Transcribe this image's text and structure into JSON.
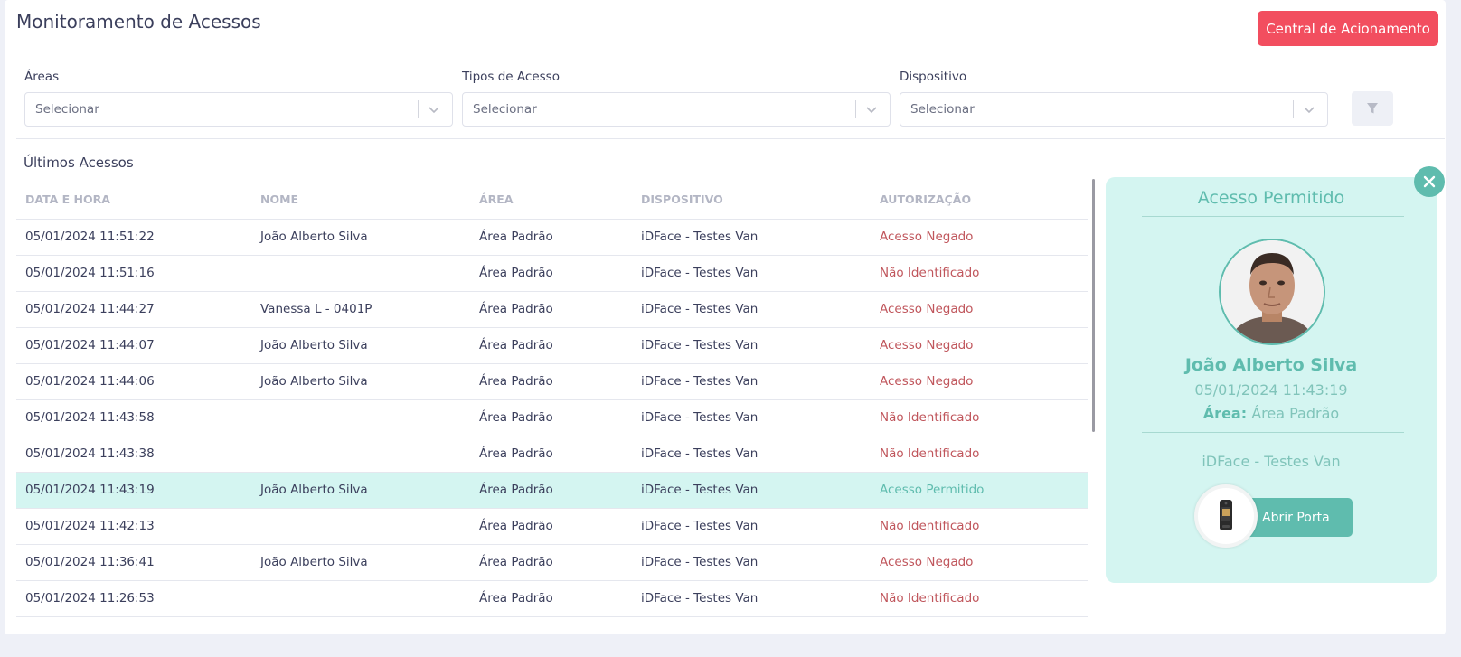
{
  "header": {
    "title": "Monitoramento de Acessos",
    "action_label": "Central de Acionamento"
  },
  "filters": {
    "areas": {
      "label": "Áreas",
      "value": "Selecionar"
    },
    "tipos": {
      "label": "Tipos de Acesso",
      "value": "Selecionar"
    },
    "dispositivo": {
      "label": "Dispositivo",
      "value": "Selecionar"
    }
  },
  "table": {
    "title": "Últimos Acessos",
    "columns": [
      "DATA E HORA",
      "NOME",
      "ÁREA",
      "DISPOSITIVO",
      "AUTORIZAÇÃO"
    ],
    "rows": [
      {
        "datetime": "05/01/2024 11:51:22",
        "name": "João Alberto Silva",
        "area": "Área Padrão",
        "device": "iDFace - Testes Van",
        "auth": "Acesso Negado"
      },
      {
        "datetime": "05/01/2024 11:51:16",
        "name": "",
        "area": "Área Padrão",
        "device": "iDFace - Testes Van",
        "auth": "Não Identificado"
      },
      {
        "datetime": "05/01/2024 11:44:27",
        "name": "Vanessa L - 0401P",
        "area": "Área Padrão",
        "device": "iDFace - Testes Van",
        "auth": "Acesso Negado"
      },
      {
        "datetime": "05/01/2024 11:44:07",
        "name": "João Alberto Silva",
        "area": "Área Padrão",
        "device": "iDFace - Testes Van",
        "auth": "Acesso Negado"
      },
      {
        "datetime": "05/01/2024 11:44:06",
        "name": "João Alberto Silva",
        "area": "Área Padrão",
        "device": "iDFace - Testes Van",
        "auth": "Acesso Negado"
      },
      {
        "datetime": "05/01/2024 11:43:58",
        "name": "",
        "area": "Área Padrão",
        "device": "iDFace - Testes Van",
        "auth": "Não Identificado"
      },
      {
        "datetime": "05/01/2024 11:43:38",
        "name": "",
        "area": "Área Padrão",
        "device": "iDFace - Testes Van",
        "auth": "Não Identificado"
      },
      {
        "datetime": "05/01/2024 11:43:19",
        "name": "João Alberto Silva",
        "area": "Área Padrão",
        "device": "iDFace - Testes Van",
        "auth": "Acesso Permitido",
        "selected": true
      },
      {
        "datetime": "05/01/2024 11:42:13",
        "name": "",
        "area": "Área Padrão",
        "device": "iDFace - Testes Van",
        "auth": "Não Identificado"
      },
      {
        "datetime": "05/01/2024 11:36:41",
        "name": "João Alberto Silva",
        "area": "Área Padrão",
        "device": "iDFace - Testes Van",
        "auth": "Acesso Negado"
      },
      {
        "datetime": "05/01/2024 11:26:53",
        "name": "",
        "area": "Área Padrão",
        "device": "iDFace - Testes Van",
        "auth": "Não Identificado"
      }
    ]
  },
  "detail": {
    "status": "Acesso Permitido",
    "name": "João Alberto Silva",
    "datetime": "05/01/2024 11:43:19",
    "area_label": "Área:",
    "area_value": "Área Padrão",
    "device": "iDFace - Testes Van",
    "open_door_label": "Abrir Porta"
  },
  "colors": {
    "accent": "#5fbcae",
    "danger": "#f24e5f",
    "denied": "#c0565c",
    "selected_row": "#d4f5f1"
  },
  "icons": {
    "filter": "filter-icon",
    "close": "close-icon",
    "chevron": "chevron-down-icon",
    "device": "face-reader-device-icon"
  }
}
